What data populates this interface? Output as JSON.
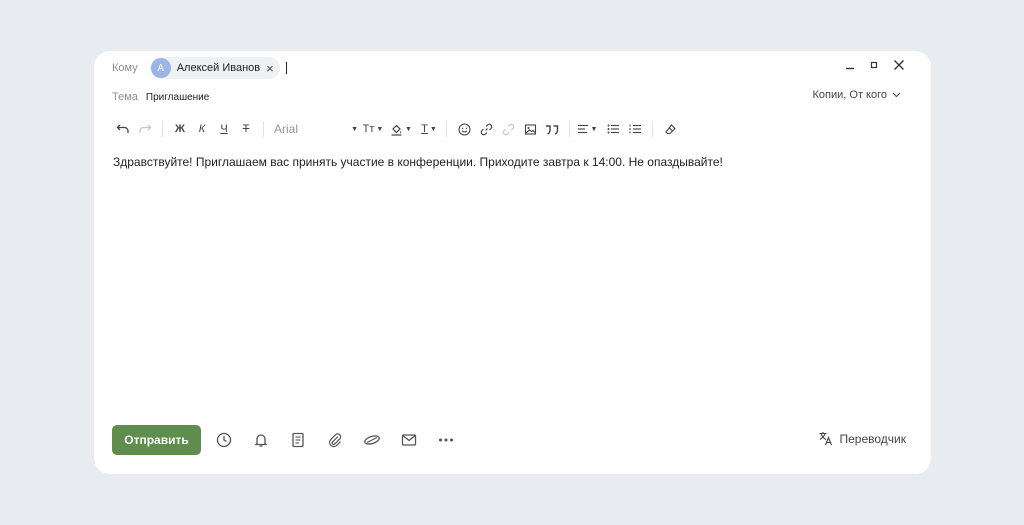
{
  "to": {
    "label": "Кому",
    "recipient": {
      "initial": "А",
      "name": "Алексей Иванов"
    }
  },
  "subject": {
    "label": "Тема",
    "value": "Приглашение"
  },
  "cc_label": "Копии, От кого",
  "toolbar": {
    "bold": "Ж",
    "italic": "К",
    "underline": "Ч",
    "strike": "Т",
    "font": "Arial",
    "size": "Тт",
    "text_color": "Т"
  },
  "body": "Здравствуйте! Приглашаем вас принять участие в конференции. Приходите завтра к 14:00. Не опаздывайте!",
  "footer": {
    "send_label": "Отправить",
    "translator_label": "Переводчик"
  },
  "colors": {
    "send_button": "#5e8d4e",
    "avatar": "#9bb6e6",
    "background": "#e8ebf0"
  }
}
